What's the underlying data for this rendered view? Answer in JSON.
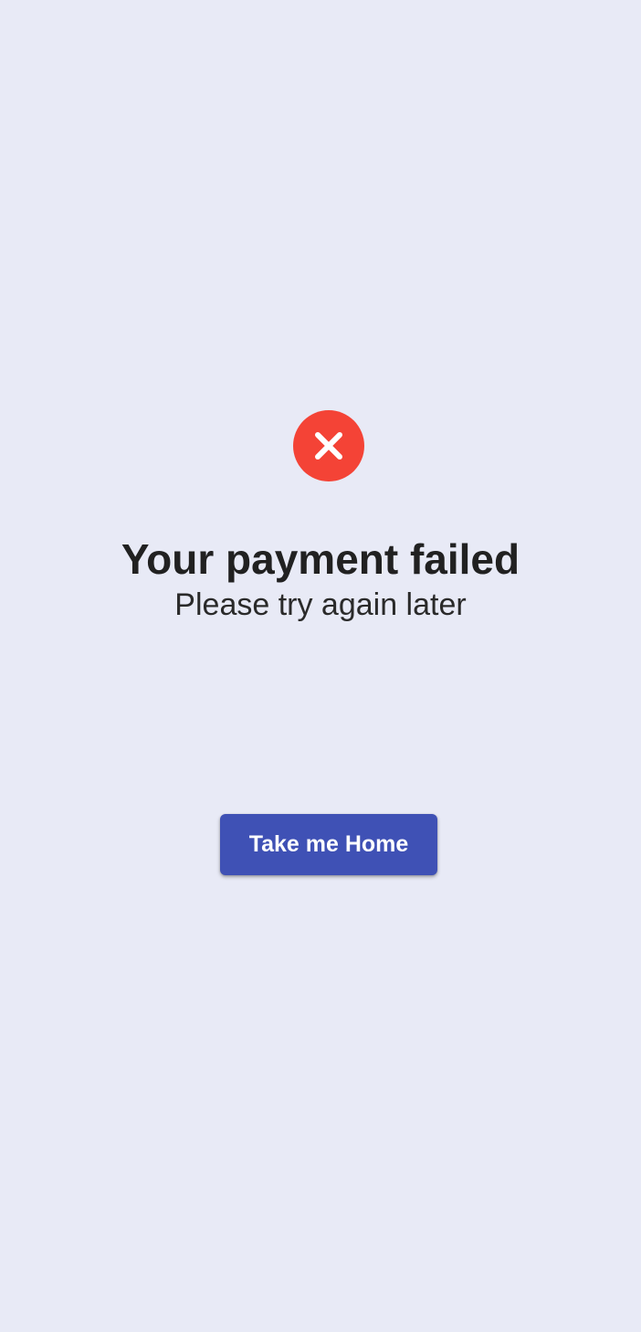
{
  "colors": {
    "background": "#e8eaf6",
    "error": "#f44336",
    "primary": "#3f51b5",
    "title_text": "#212121"
  },
  "status": {
    "icon": "close-circle-icon",
    "title": "Your payment failed",
    "subtitle": "Please try again later"
  },
  "actions": {
    "home_label": "Take me Home"
  }
}
